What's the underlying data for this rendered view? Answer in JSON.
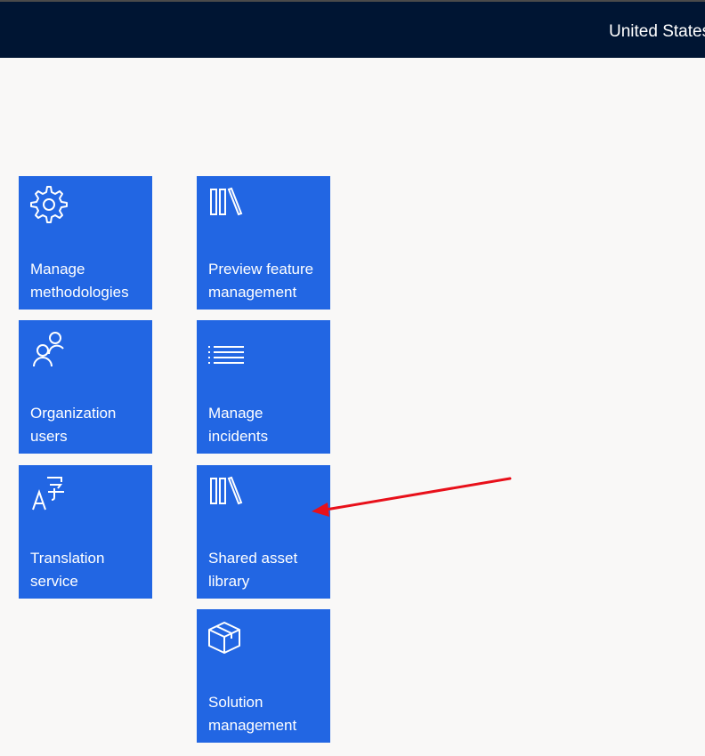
{
  "header": {
    "region_label": "United States"
  },
  "tiles": [
    {
      "label_line1": "Manage",
      "label_line2": "methodologies",
      "icon": "gear-icon"
    },
    {
      "label_line1": "Organization",
      "label_line2": "users",
      "icon": "people-icon"
    },
    {
      "label_line1": "Translation",
      "label_line2": "service",
      "icon": "translate-icon"
    },
    {
      "label_line1": "Preview feature",
      "label_line2": "management",
      "icon": "library-icon"
    },
    {
      "label_line1": "Manage",
      "label_line2": "incidents",
      "icon": "list-icon"
    },
    {
      "label_line1": "Shared asset",
      "label_line2": "library",
      "icon": "library-icon"
    },
    {
      "label_line1": "Solution",
      "label_line2": "management",
      "icon": "package-icon"
    }
  ],
  "colors": {
    "header_bg": "#001533",
    "tile_bg": "#2266e3",
    "page_bg": "#f9f8f7",
    "annotation_arrow": "#e8101a"
  }
}
